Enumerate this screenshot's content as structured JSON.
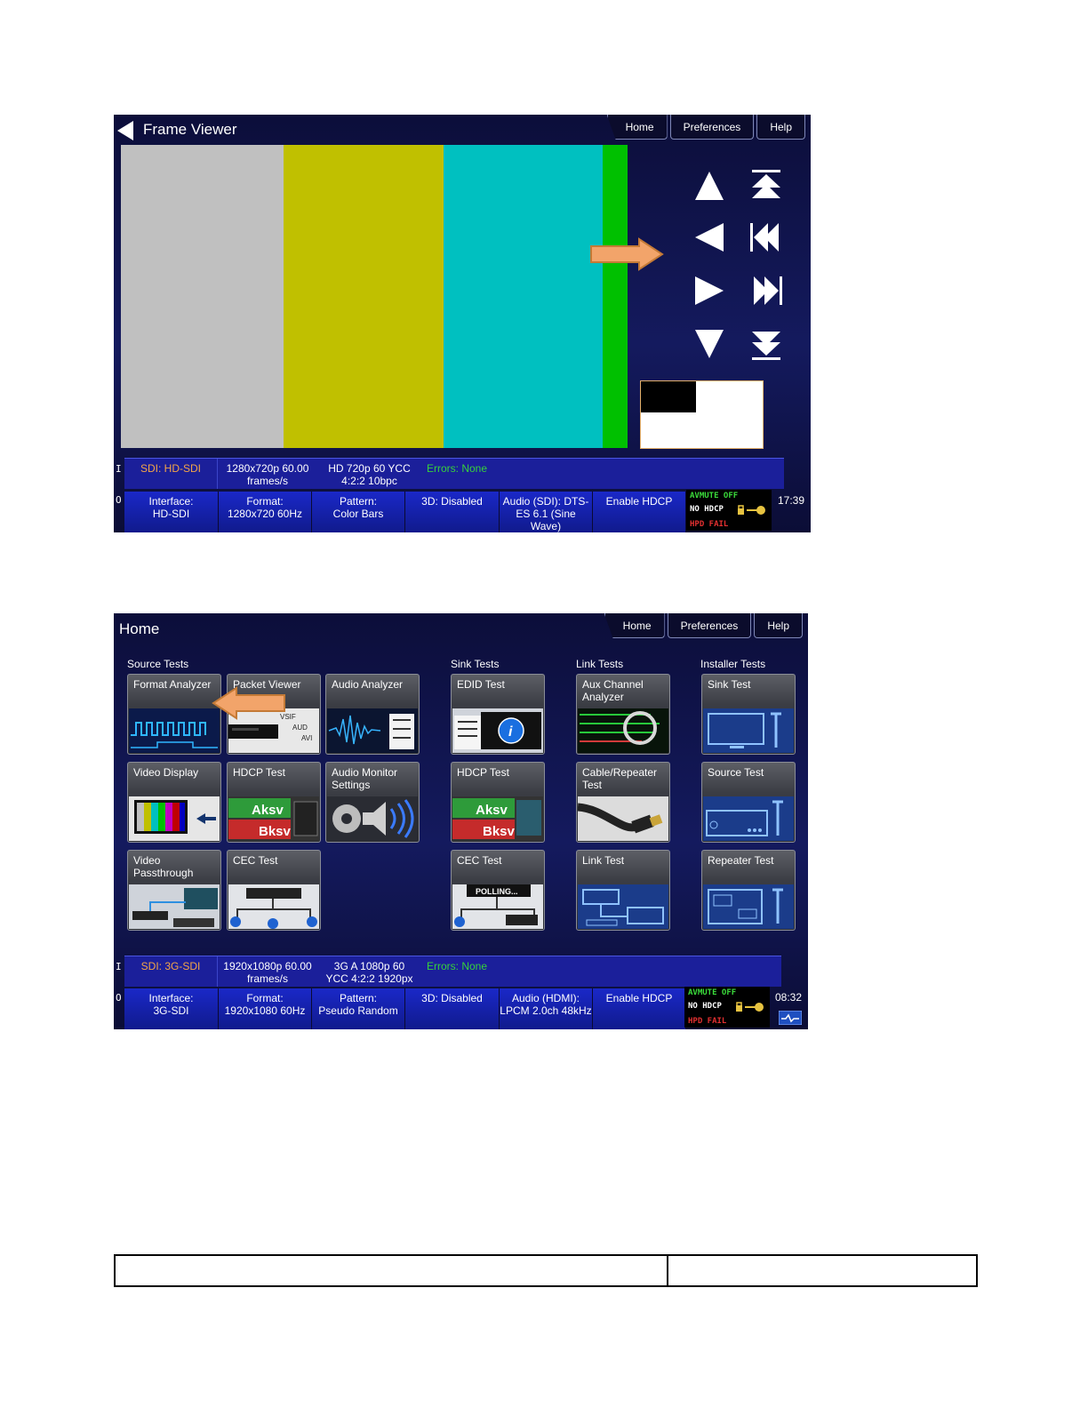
{
  "nav": {
    "home": "Home",
    "preferences": "Preferences",
    "help": "Help"
  },
  "screen1": {
    "title": "Frame Viewer",
    "colors": [
      "#c0c0c0",
      "#c0c000",
      "#00c0c0",
      "#00c000"
    ],
    "in_bar": {
      "signal": "SDI: HD-SDI",
      "timing": "1280x720p 60.00 frames/s",
      "format": "HD 720p 60 YCC 4:2:2 10bpc",
      "errors": "Errors: None"
    },
    "out_bar": [
      {
        "label": "Interface:",
        "value": "HD-SDI"
      },
      {
        "label": "Format:",
        "value": "1280x720 60Hz"
      },
      {
        "label": "Pattern:",
        "value": "Color Bars"
      },
      {
        "label": "3D: Disabled",
        "value": ""
      },
      {
        "label": "Audio (SDI): DTS-ES 6.1 (Sine Wave)",
        "value": ""
      },
      {
        "label": "Enable HDCP",
        "value": ""
      }
    ],
    "status": {
      "av_mute": "AVMUTE OFF",
      "hdcp": "NO HDCP",
      "hpd": "HPD FAIL"
    },
    "time": "17:39"
  },
  "screen2": {
    "title": "Home",
    "sections": {
      "source": "Source Tests",
      "sink": "Sink Tests",
      "link": "Link Tests",
      "installer": "Installer Tests"
    },
    "tiles": {
      "format_analyzer": "Format Analyzer",
      "packet_viewer": "Packet Viewer",
      "audio_analyzer": "Audio Analyzer",
      "edid_test": "EDID Test",
      "aux_channel_analyzer": "Aux Channel Analyzer",
      "sink_test": "Sink Test",
      "video_display": "Video Display",
      "hdcp_test_source": "HDCP Test",
      "audio_monitor_settings": "Audio Monitor Settings",
      "hdcp_test_sink": "HDCP Test",
      "cable_repeater_test": "Cable/Repeater Test",
      "source_test": "Source Test",
      "video_passthrough": "Video Passthrough",
      "cec_test_source": "CEC Test",
      "cec_test_sink": "CEC Test",
      "link_test": "Link Test",
      "repeater_test": "Repeater Test"
    },
    "tile_texts": {
      "packet_vsif": "VSIF",
      "packet_aud": "AUD",
      "packet_avi": "AVI",
      "aksv": "Aksv",
      "bksv": "Bksv",
      "polling": "POLLING..."
    },
    "in_bar": {
      "signal": "SDI: 3G-SDI",
      "timing": "1920x1080p 60.00 frames/s",
      "format": "3G A 1080p 60 YCC 4:2:2 1920px",
      "errors": "Errors: None"
    },
    "out_bar": [
      {
        "label": "Interface:",
        "value": "3G-SDI"
      },
      {
        "label": "Format:",
        "value": "1920x1080 60Hz"
      },
      {
        "label": "Pattern:",
        "value": "Pseudo Random"
      },
      {
        "label": "3D: Disabled",
        "value": ""
      },
      {
        "label": "Audio (HDMI): LPCM 2.0ch 48kHz",
        "value": ""
      },
      {
        "label": "Enable HDCP",
        "value": ""
      }
    ],
    "status": {
      "av_mute": "AVMUTE OFF",
      "hdcp": "NO HDCP",
      "hpd": "HPD FAIL"
    },
    "time": "08:32"
  },
  "io": {
    "in": "I N",
    "out": "O U T"
  }
}
